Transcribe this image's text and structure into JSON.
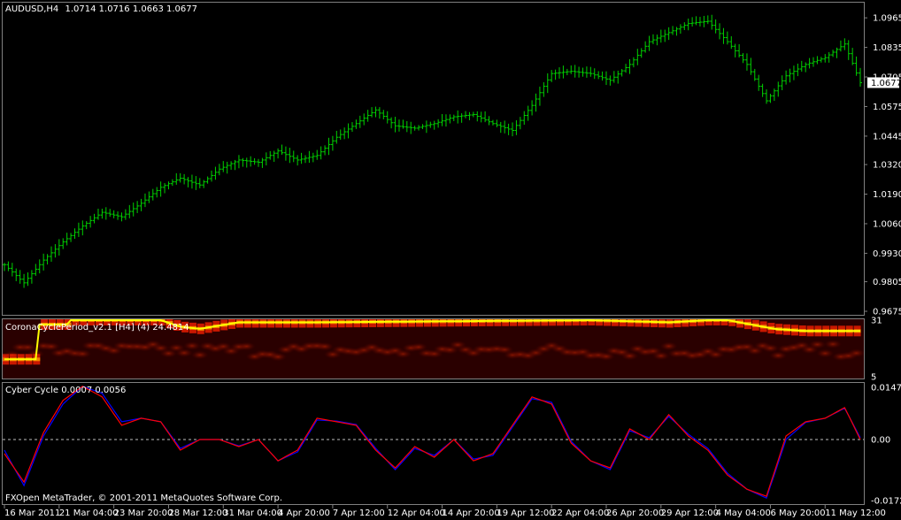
{
  "chart_data": [
    {
      "type": "ohlc",
      "title": "AUDUSD,H4",
      "ohlc_readout": "1.0714 1.0716 1.0663 1.0677",
      "current_price_label": "1.0677",
      "ylim": [
        0.9675,
        1.102
      ],
      "yticks": [
        "0.9675",
        "0.9805",
        "0.9930",
        "1.0060",
        "1.0190",
        "1.0320",
        "1.0445",
        "1.0575",
        "1.0705",
        "1.0835",
        "1.0965"
      ],
      "colors": {
        "bars": "#00d000",
        "price_box": "#ffffff"
      },
      "close_series": {
        "index": [
          0,
          5,
          10,
          15,
          20,
          25,
          30,
          35,
          40,
          45,
          50,
          55,
          60,
          65,
          70,
          75,
          80,
          85,
          90,
          95,
          100,
          105,
          110,
          115,
          120,
          125,
          130,
          135,
          140,
          145,
          150,
          155,
          160,
          165,
          170,
          175,
          180,
          185,
          190,
          195,
          200,
          205,
          210,
          215,
          219
        ],
        "values": [
          0.988,
          0.98,
          0.99,
          0.998,
          1.005,
          1.011,
          1.009,
          1.015,
          1.022,
          1.026,
          1.023,
          1.03,
          1.034,
          1.033,
          1.038,
          1.034,
          1.036,
          1.044,
          1.05,
          1.056,
          1.049,
          1.048,
          1.05,
          1.053,
          1.054,
          1.05,
          1.047,
          1.058,
          1.072,
          1.073,
          1.072,
          1.069,
          1.076,
          1.086,
          1.09,
          1.094,
          1.095,
          1.086,
          1.076,
          1.06,
          1.071,
          1.076,
          1.079,
          1.085,
          1.068
        ]
      }
    },
    {
      "type": "heatmap",
      "title": "CoronaCyclePeriod_v2.1 [H4] (4) 24.4814",
      "ylim": [
        5,
        31
      ],
      "yticks": [
        "31",
        "5"
      ],
      "line_color": "#ffff00",
      "dominant_period": {
        "index": [
          0,
          8,
          9,
          16,
          17,
          40,
          45,
          50,
          60,
          75,
          80,
          150,
          170,
          180,
          185,
          197,
          205,
          219
        ],
        "values": [
          13,
          13,
          29,
          29,
          31,
          31,
          28,
          27,
          30,
          30,
          30,
          31,
          30,
          31,
          31,
          27,
          26,
          26
        ]
      }
    },
    {
      "type": "line",
      "title": "Cyber Cycle 0.0007 0.0056",
      "ylim": [
        -0.0172,
        0.0147
      ],
      "yticks": [
        "0.0147",
        "0.00",
        "-0.0172"
      ],
      "zero_line": true,
      "series": [
        {
          "color": "#ff0000",
          "index": [
            0,
            5,
            10,
            15,
            20,
            25,
            30,
            35,
            40,
            45,
            50,
            55,
            60,
            65,
            70,
            75,
            80,
            85,
            90,
            95,
            100,
            105,
            110,
            115,
            120,
            125,
            130,
            135,
            140,
            145,
            150,
            155,
            160,
            165,
            170,
            175,
            180,
            185,
            190,
            195,
            200,
            205,
            210,
            215,
            219
          ],
          "values": [
            -0.004,
            -0.012,
            0.002,
            0.011,
            0.015,
            0.012,
            0.004,
            0.006,
            0.005,
            -0.003,
            0.0,
            0.0,
            -0.002,
            0.0,
            -0.006,
            -0.003,
            0.006,
            0.005,
            0.004,
            -0.003,
            -0.008,
            -0.002,
            -0.005,
            0.0,
            -0.006,
            -0.004,
            0.004,
            0.012,
            0.01,
            -0.001,
            -0.006,
            -0.008,
            0.003,
            0.0,
            0.007,
            0.001,
            -0.003,
            -0.01,
            -0.014,
            -0.016,
            0.001,
            0.005,
            0.006,
            0.009,
            0.0
          ]
        },
        {
          "color": "#0000ff",
          "index": [
            0,
            5,
            10,
            15,
            20,
            25,
            30,
            35,
            40,
            45,
            50,
            55,
            60,
            65,
            70,
            75,
            80,
            85,
            90,
            95,
            100,
            105,
            110,
            115,
            120,
            125,
            130,
            135,
            140,
            145,
            150,
            155,
            160,
            165,
            170,
            175,
            180,
            185,
            190,
            195,
            200,
            205,
            210,
            215,
            219
          ],
          "values": [
            -0.003,
            -0.013,
            0.001,
            0.01,
            0.015,
            0.013,
            0.005,
            0.006,
            0.005,
            -0.0025,
            0.0,
            0.0,
            -0.0018,
            0.0,
            -0.006,
            -0.0035,
            0.0055,
            0.0052,
            0.0042,
            -0.0025,
            -0.0085,
            -0.0025,
            -0.0045,
            0.0,
            -0.0055,
            -0.0045,
            0.0035,
            0.0115,
            0.0105,
            -0.0005,
            -0.006,
            -0.0085,
            0.0025,
            0.0005,
            0.0065,
            0.0015,
            -0.0025,
            -0.0095,
            -0.014,
            -0.0165,
            0.0,
            0.0048,
            0.006,
            0.0088,
            0.0005
          ]
        }
      ]
    }
  ],
  "x_axis": {
    "bar_count": 220,
    "labels": [
      "16 Mar 2011",
      "21 Mar 04:00",
      "23 Mar 20:00",
      "28 Mar 12:00",
      "31 Mar 04:00",
      "4 Apr 20:00",
      "7 Apr 12:00",
      "12 Apr 04:00",
      "14 Apr 20:00",
      "19 Apr 12:00",
      "22 Apr 04:00",
      "26 Apr 20:00",
      "29 Apr 12:00",
      "4 May 04:00",
      "6 May 20:00",
      "11 May 12:00"
    ],
    "label_bar_index": [
      0,
      14,
      28,
      42,
      56,
      70,
      84,
      98,
      112,
      126,
      140,
      154,
      168,
      182,
      196,
      210
    ]
  },
  "footer": "FXOpen MetaTrader, © 2001-2011 MetaQuotes Software Corp."
}
